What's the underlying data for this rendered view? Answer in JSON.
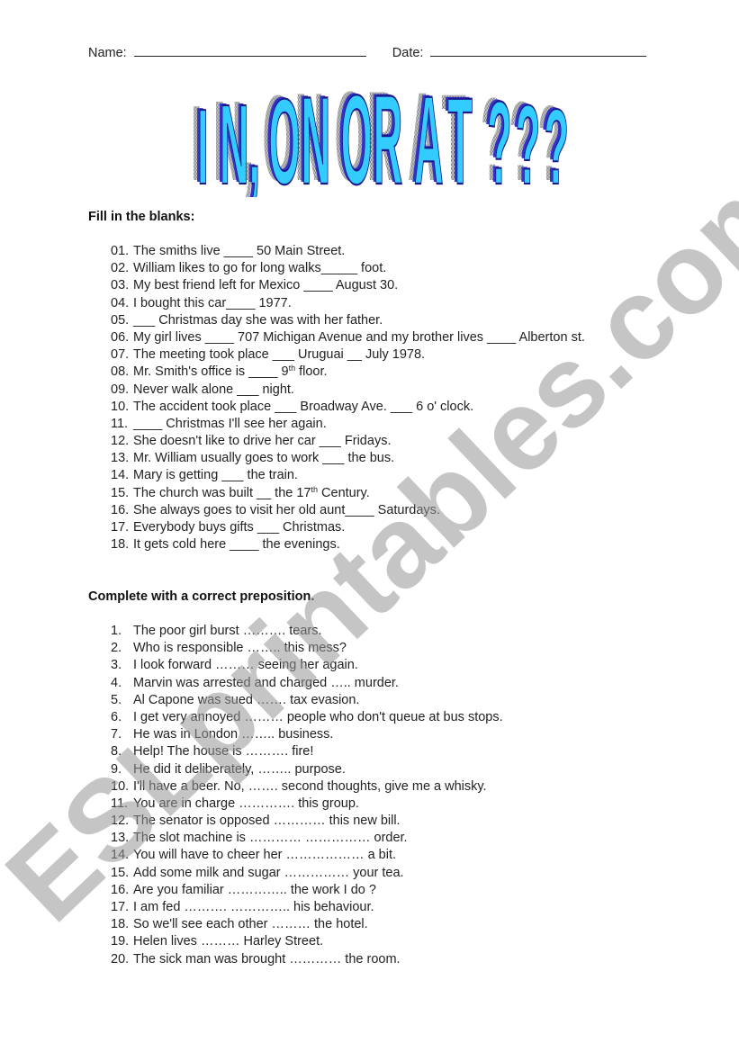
{
  "header": {
    "name_label": "Name:",
    "date_label": "Date:"
  },
  "title": {
    "text": "IN, ON OR AT ???",
    "fill_color": "#33ccff",
    "shadow_color": "#3333cc"
  },
  "section1": {
    "heading": "Fill in the blanks:",
    "items": [
      {
        "num": "01.",
        "text": "The smiths live ____ 50 Main Street."
      },
      {
        "num": "02.",
        "text": "William likes to go for long walks_____ foot."
      },
      {
        "num": "03.",
        "text": "My best friend left for Mexico ____ August 30."
      },
      {
        "num": "04.",
        "text": "I bought this car____ 1977."
      },
      {
        "num": "05.",
        "text": "___ Christmas day she was with her father."
      },
      {
        "num": "06.",
        "text": "My girl lives ____ 707 Michigan Avenue and my brother lives ____ Alberton st."
      },
      {
        "num": "07.",
        "text": "The meeting took place ___ Uruguai __ July 1978."
      },
      {
        "num": "08.",
        "text_before": "Mr. Smith's office is ____ 9",
        "sup": "th",
        "text_after": " floor."
      },
      {
        "num": "09.",
        "text": "Never walk alone ___ night."
      },
      {
        "num": "10.",
        "text": "The accident took place ___ Broadway Ave. ___ 6 o' clock."
      },
      {
        "num": "11.",
        "text": "____ Christmas I'll see her again."
      },
      {
        "num": "12.",
        "text": "She doesn't like to drive her car ___ Fridays."
      },
      {
        "num": "13.",
        "text": "Mr. William usually goes to work ___ the bus."
      },
      {
        "num": "14.",
        "text": "Mary is getting ___ the train."
      },
      {
        "num": "15.",
        "text_before": "The church was built __ the 17",
        "sup": "th",
        "text_after": " Century."
      },
      {
        "num": "16.",
        "text": "She always goes to visit her old aunt____ Saturdays."
      },
      {
        "num": "17.",
        "text": "Everybody buys gifts ___ Christmas."
      },
      {
        "num": "18.",
        "text": "It gets cold here ____ the evenings."
      }
    ]
  },
  "section2": {
    "heading": "Complete with a correct preposition.",
    "items": [
      {
        "num": "1.",
        "text": "The poor girl burst ………. tears."
      },
      {
        "num": "2.",
        "text": "Who is responsible …….. this mess?"
      },
      {
        "num": "3.",
        "text": "I look forward ……… seeing her again."
      },
      {
        "num": "4.",
        "text": "Marvin was arrested and charged ….. murder."
      },
      {
        "num": "5.",
        "text": "Al Capone was sued ……. tax evasion."
      },
      {
        "num": "6.",
        "text": "I get very annoyed ……… people who don't queue at bus stops."
      },
      {
        "num": "7.",
        "text": "He was in London …….. business."
      },
      {
        "num": "8.",
        "text": "Help! The house is ………. fire!"
      },
      {
        "num": "9.",
        "text": "He did it deliberately, …….. purpose."
      },
      {
        "num": "10.",
        "text": "I'll have a beer. No, ……. second thoughts, give me a whisky."
      },
      {
        "num": "11.",
        "text": "You are in charge …………. this group."
      },
      {
        "num": "12.",
        "text": "The senator is opposed ………… this new bill."
      },
      {
        "num": "13.",
        "text": "The slot machine is ………… …………… order."
      },
      {
        "num": "14.",
        "text": "You will have to cheer her ……………… a bit."
      },
      {
        "num": "15.",
        "text": "Add some milk and sugar …………… your tea."
      },
      {
        "num": "16.",
        "text": "Are you familiar ………….. the work I do ?"
      },
      {
        "num": "17.",
        "text": "I am fed ………. ………….. his behaviour."
      },
      {
        "num": "18.",
        "text": "So we'll see each other ……… the hotel."
      },
      {
        "num": "19.",
        "text": "Helen lives ……… Harley Street."
      },
      {
        "num": "20.",
        "text": "The sick man was brought ………… the room."
      }
    ]
  },
  "watermark": {
    "text": "ESLprintables.com",
    "color": "#a0a0a0"
  }
}
